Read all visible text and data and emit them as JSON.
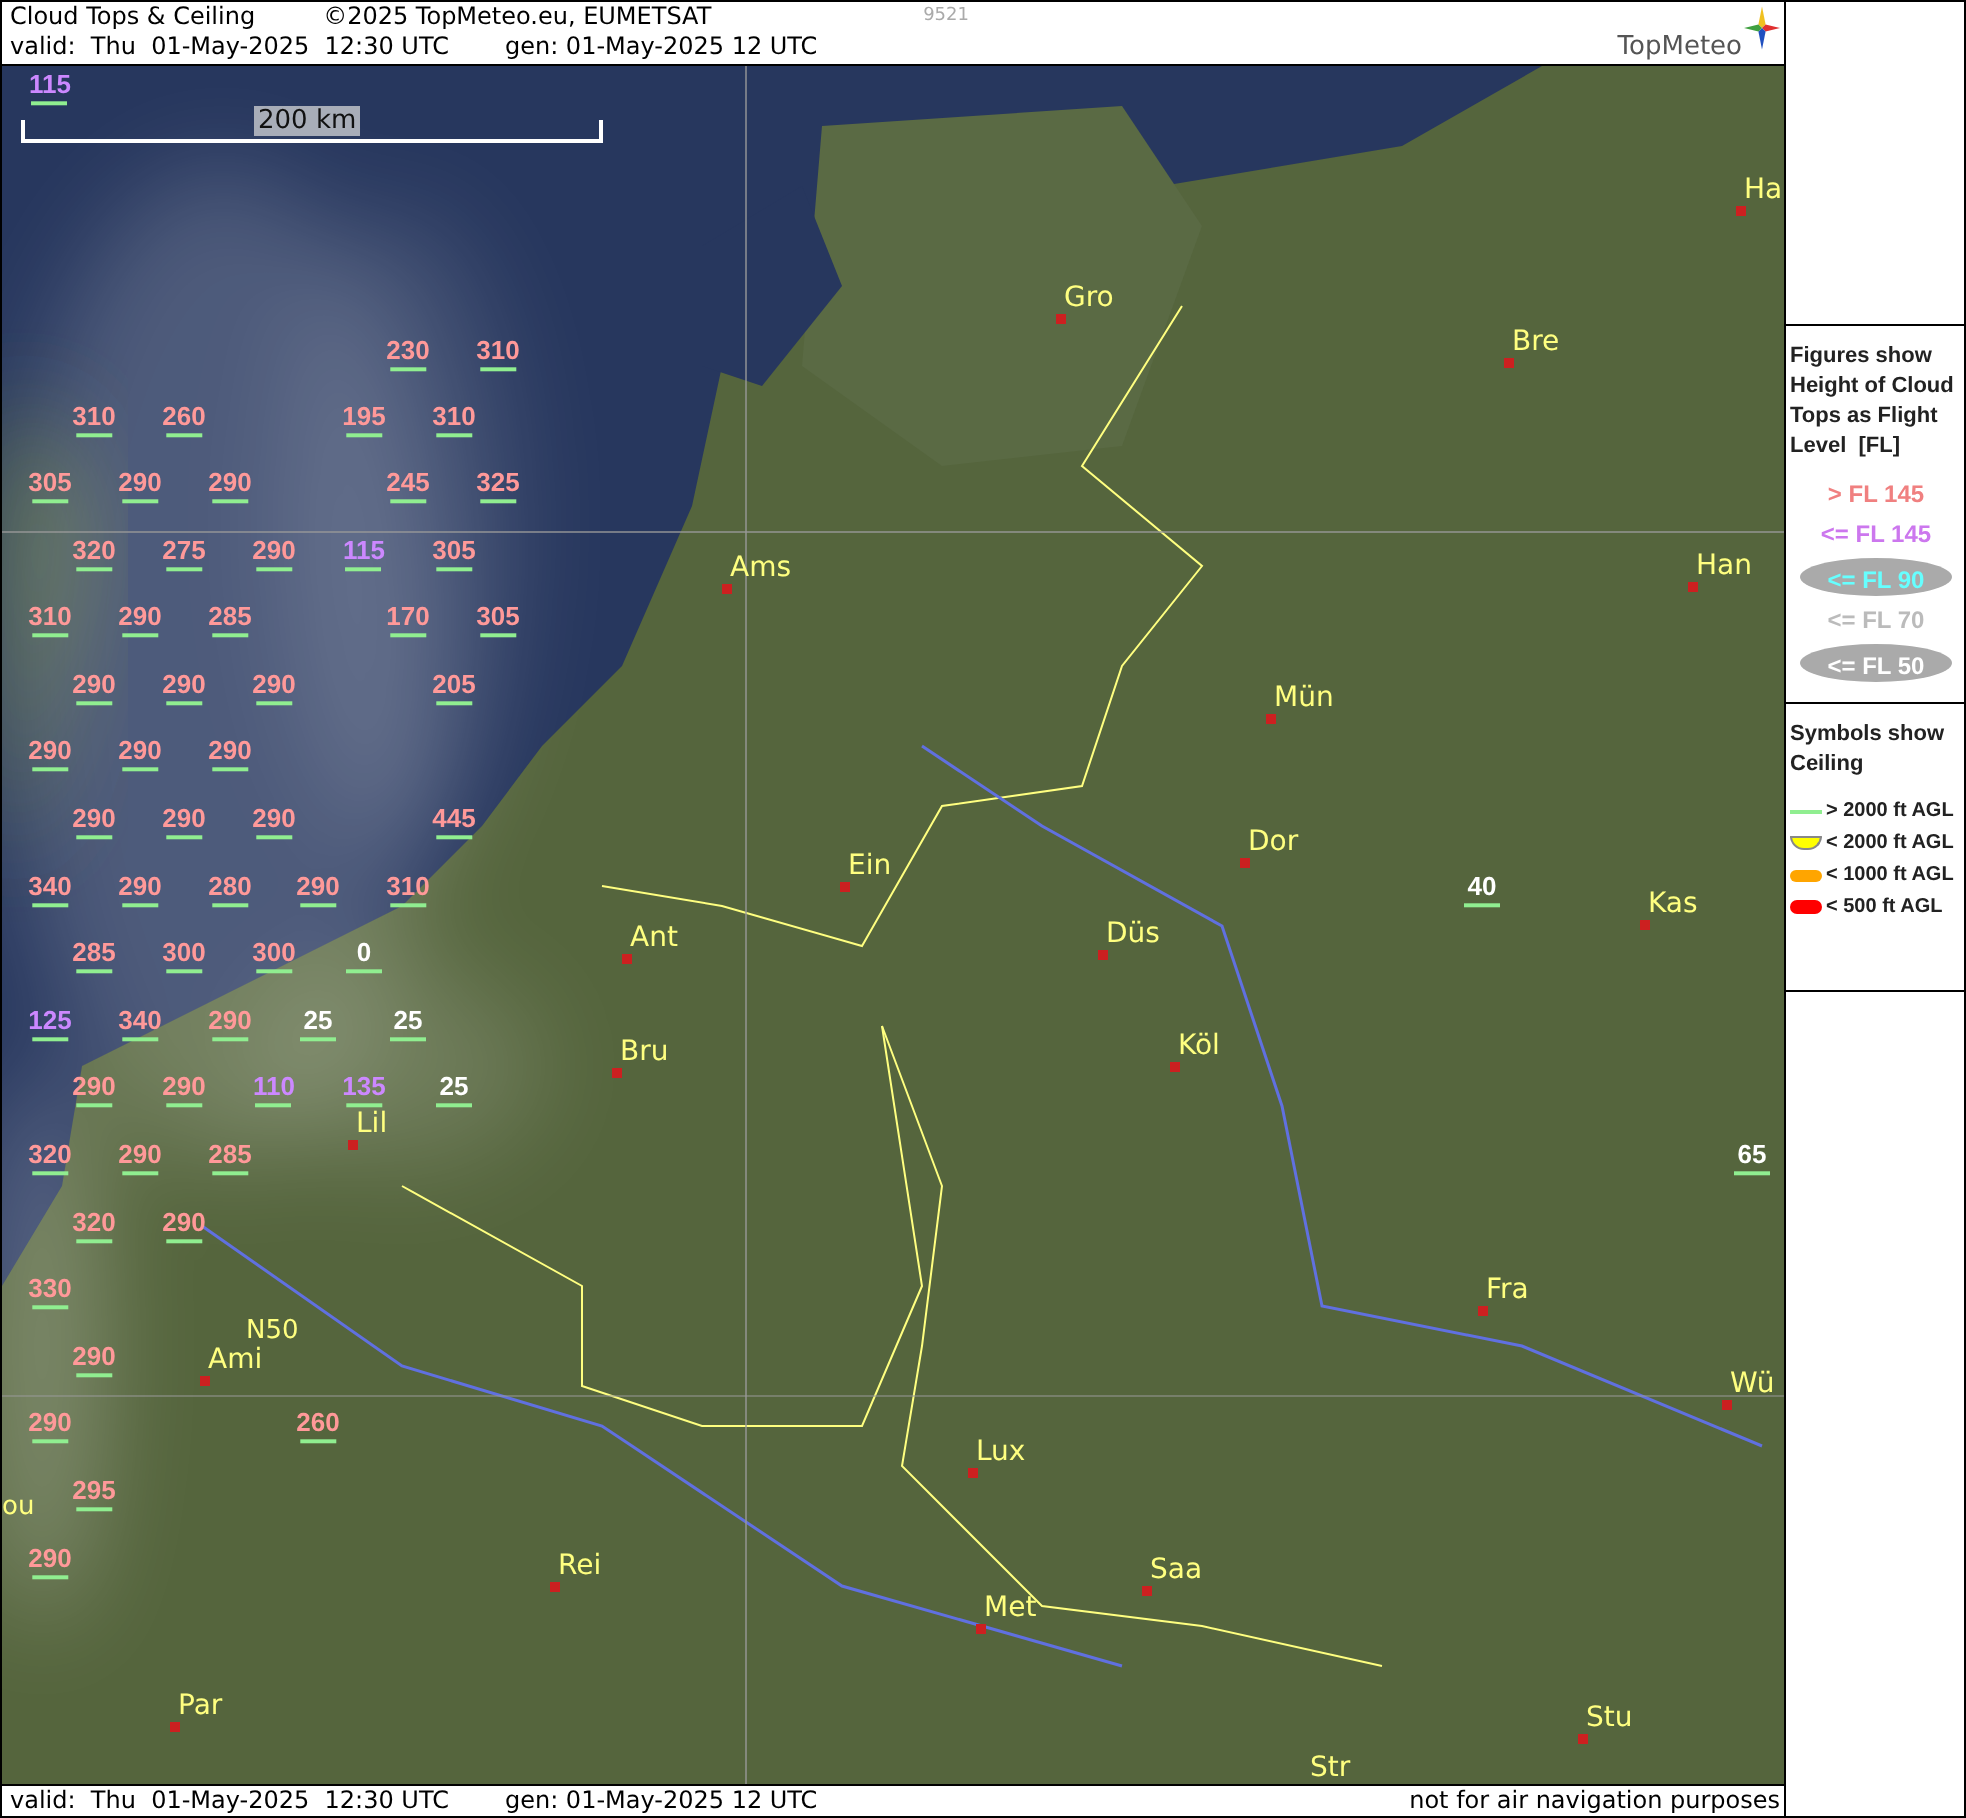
{
  "header": {
    "title": "Cloud Tops & Ceiling",
    "copyright": "©2025 TopMeteo.eu, EUMETSAT",
    "code": "9521",
    "valid": "valid:  Thu  01-May-2025  12:30 UTC",
    "generated": "gen: 01-May-2025 12 UTC",
    "logo": "TopMeteo"
  },
  "map": {
    "scale_label": "200 km",
    "figures": [
      {
        "value": "115",
        "color": "#cc88ff"
      },
      {
        "value": "230",
        "color": "#ff9999"
      },
      {
        "value": "310",
        "color": "#ff9999"
      },
      {
        "value": "310",
        "color": "#ff9999"
      },
      {
        "value": "260",
        "color": "#ff9999"
      },
      {
        "value": "195",
        "color": "#ff9999"
      },
      {
        "value": "310",
        "color": "#ff9999"
      },
      {
        "value": "305",
        "color": "#ff9999"
      },
      {
        "value": "290",
        "color": "#ff9999"
      },
      {
        "value": "290",
        "color": "#ff9999"
      },
      {
        "value": "245",
        "color": "#ff9999"
      },
      {
        "value": "325",
        "color": "#ff9999"
      },
      {
        "value": "320",
        "color": "#ff9999"
      },
      {
        "value": "275",
        "color": "#ff9999"
      },
      {
        "value": "290",
        "color": "#ff9999"
      },
      {
        "value": "115",
        "color": "#cc88ff"
      },
      {
        "value": "305",
        "color": "#ff9999"
      },
      {
        "value": "310",
        "color": "#ff9999"
      },
      {
        "value": "290",
        "color": "#ff9999"
      },
      {
        "value": "285",
        "color": "#ff9999"
      },
      {
        "value": "170",
        "color": "#ff9999"
      },
      {
        "value": "305",
        "color": "#ff9999"
      },
      {
        "value": "290",
        "color": "#ff9999"
      },
      {
        "value": "290",
        "color": "#ff9999"
      },
      {
        "value": "290",
        "color": "#ff9999"
      },
      {
        "value": "205",
        "color": "#ff9999"
      },
      {
        "value": "290",
        "color": "#ff9999"
      },
      {
        "value": "290",
        "color": "#ff9999"
      },
      {
        "value": "290",
        "color": "#ff9999"
      },
      {
        "value": "290",
        "color": "#ff9999"
      },
      {
        "value": "290",
        "color": "#ff9999"
      },
      {
        "value": "290",
        "color": "#ff9999"
      },
      {
        "value": "445",
        "color": "#ff9999"
      },
      {
        "value": "340",
        "color": "#ff9999"
      },
      {
        "value": "290",
        "color": "#ff9999"
      },
      {
        "value": "280",
        "color": "#ff9999"
      },
      {
        "value": "290",
        "color": "#ff9999"
      },
      {
        "value": "310",
        "color": "#ff9999"
      },
      {
        "value": "285",
        "color": "#ff9999"
      },
      {
        "value": "300",
        "color": "#ff9999"
      },
      {
        "value": "300",
        "color": "#ff9999"
      },
      {
        "value": "0",
        "color": "#ffffff"
      },
      {
        "value": "125",
        "color": "#cc88ff"
      },
      {
        "value": "340",
        "color": "#ff9999"
      },
      {
        "value": "290",
        "color": "#ff9999"
      },
      {
        "value": "25",
        "color": "#ffffff"
      },
      {
        "value": "25",
        "color": "#ffffff"
      },
      {
        "value": "290",
        "color": "#ff9999"
      },
      {
        "value": "290",
        "color": "#ff9999"
      },
      {
        "value": "110",
        "color": "#cc88ff"
      },
      {
        "value": "135",
        "color": "#cc88ff"
      },
      {
        "value": "25",
        "color": "#ffffff"
      },
      {
        "value": "320",
        "color": "#ff9999"
      },
      {
        "value": "290",
        "color": "#ff9999"
      },
      {
        "value": "285",
        "color": "#ff9999"
      },
      {
        "value": "320",
        "color": "#ff9999"
      },
      {
        "value": "290",
        "color": "#ff9999"
      },
      {
        "value": "330",
        "color": "#ff9999"
      },
      {
        "value": "290",
        "color": "#ff9999"
      },
      {
        "value": "290",
        "color": "#ff9999"
      },
      {
        "value": "260",
        "color": "#ff9999"
      },
      {
        "value": "295",
        "color": "#ff9999"
      },
      {
        "value": "290",
        "color": "#ff9999"
      },
      {
        "value": "40",
        "color": "#ffffff"
      },
      {
        "value": "65",
        "color": "#ffffff"
      }
    ],
    "places": [
      {
        "name": "Ha",
        "kind": "city"
      },
      {
        "name": "Gro",
        "kind": "city"
      },
      {
        "name": "Bre",
        "kind": "city"
      },
      {
        "name": "Ams",
        "kind": "city"
      },
      {
        "name": "Han",
        "kind": "city"
      },
      {
        "name": "Mün",
        "kind": "city"
      },
      {
        "name": "Dor",
        "kind": "city"
      },
      {
        "name": "Ein",
        "kind": "city"
      },
      {
        "name": "Ant",
        "kind": "city"
      },
      {
        "name": "Düs",
        "kind": "city"
      },
      {
        "name": "Kas",
        "kind": "city"
      },
      {
        "name": "Bru",
        "kind": "city"
      },
      {
        "name": "Köl",
        "kind": "city"
      },
      {
        "name": "Lil",
        "kind": "city"
      },
      {
        "name": "Fra",
        "kind": "city"
      },
      {
        "name": "N50",
        "kind": "label"
      },
      {
        "name": "Ami",
        "kind": "city"
      },
      {
        "name": "Wü",
        "kind": "city"
      },
      {
        "name": "Lux",
        "kind": "city"
      },
      {
        "name": "ou",
        "kind": "label"
      },
      {
        "name": "Saa",
        "kind": "city"
      },
      {
        "name": "Rei",
        "kind": "city"
      },
      {
        "name": "Met",
        "kind": "city"
      },
      {
        "name": "Par",
        "kind": "city"
      },
      {
        "name": "Stu",
        "kind": "city"
      },
      {
        "name": "Str",
        "kind": "city"
      }
    ]
  },
  "footer": {
    "valid": "valid:  Thu  01-May-2025  12:30 UTC",
    "generated": "gen: 01-May-2025 12 UTC",
    "notice": "not for air navigation purposes"
  },
  "legend_figures": {
    "title": "Figures show Height of Cloud Tops as Flight Level  [FL]",
    "items": [
      {
        "label": "> FL 145",
        "color": "#f08080",
        "kind": "plain"
      },
      {
        "label": "<= FL 145",
        "color": "#cc77ee",
        "kind": "plain"
      },
      {
        "label": "<= FL 90",
        "color": "#66ffff",
        "kind": "oval"
      },
      {
        "label": "<= FL 70",
        "color": "#bbbbbb",
        "kind": "plain"
      },
      {
        "label": "<= FL 50",
        "color": "#ffffff",
        "kind": "oval"
      }
    ]
  },
  "legend_symbols": {
    "title": "Symbols show Ceiling",
    "items": [
      {
        "label": "> 2000 ft AGL",
        "color": "#90ee90",
        "kind": "line"
      },
      {
        "label": "< 2000 ft AGL",
        "color": "#ffff00",
        "kind": "cup"
      },
      {
        "label": "< 1000 ft AGL",
        "color": "#ffa500",
        "kind": "dash"
      },
      {
        "label": "< 500 ft AGL",
        "color": "#ff0000",
        "kind": "blob"
      }
    ]
  }
}
